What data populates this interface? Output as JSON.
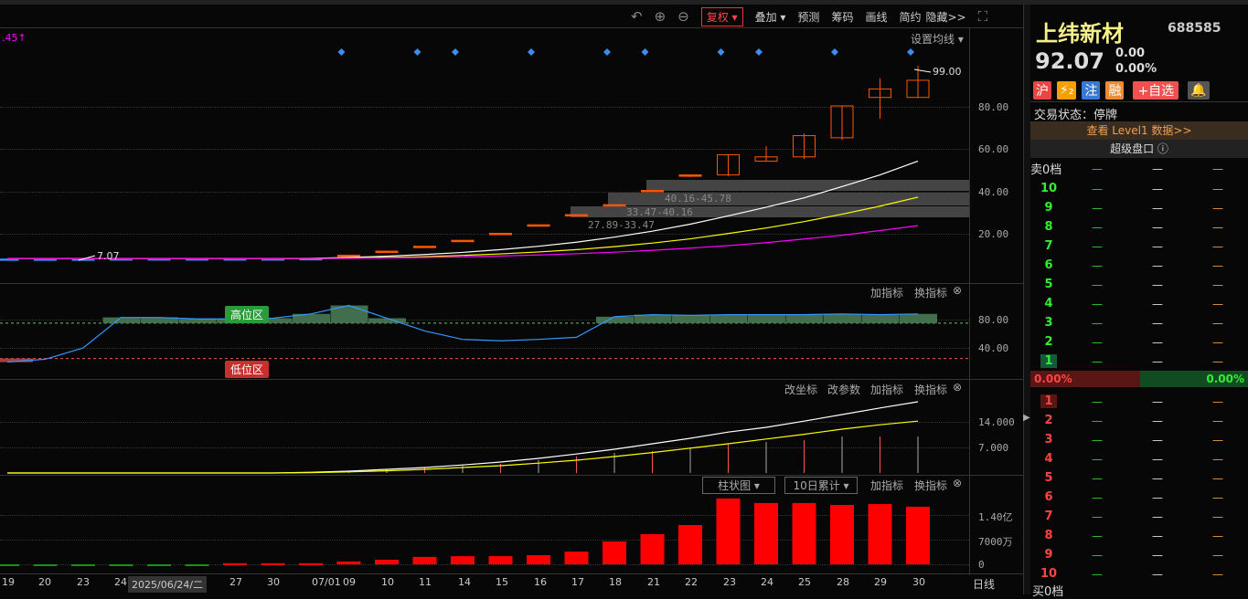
{
  "toolbar": {
    "icons": [
      "undo-icon",
      "zoom-in-icon",
      "zoom-out-icon",
      "fullscreen-icon"
    ],
    "fuquan": "复权 ▾",
    "overlay": "叠加 ▾",
    "forecast": "预测",
    "chips": "筹码",
    "draw": "画线",
    "simple": "简约",
    "hide": "隐藏>>"
  },
  "main": {
    "top_left": ".45↑",
    "ma_setting": "设置均线 ▾",
    "max_label": "99.00",
    "min_label": "7.07",
    "price_ticks": [
      "80.00",
      "60.00",
      "40.00",
      "20.00"
    ],
    "chip_labels": [
      "40.16-45.78",
      "33.47-40.16",
      "27.89-33.47"
    ]
  },
  "osc": {
    "add": "加指标",
    "switch": "换指标",
    "high": "高位区",
    "low": "低位区",
    "ticks": [
      "80.00",
      "40.00"
    ]
  },
  "ind": {
    "coord": "改坐标",
    "param": "改参数",
    "add": "加指标",
    "switch": "换指标",
    "ticks": [
      "14.000",
      "7.000"
    ]
  },
  "vol": {
    "type": "柱状图 ▾",
    "accum": "10日累计 ▾",
    "add": "加指标",
    "switch": "换指标",
    "ticks": [
      "1.40亿",
      "7000万",
      "0"
    ]
  },
  "dates": [
    "19",
    "20",
    "23",
    "24",
    "2025/06/24/二",
    "27",
    "30",
    "07/01",
    "09",
    "10",
    "11",
    "14",
    "15",
    "16",
    "17",
    "18",
    "21",
    "22",
    "23",
    "24",
    "25",
    "28",
    "29",
    "30"
  ],
  "period": "日线",
  "chart_data": {
    "type": "candlestick",
    "x": [
      "19",
      "20",
      "23",
      "24",
      "25",
      "26",
      "27",
      "30",
      "07/01",
      "09",
      "10",
      "11",
      "14",
      "15",
      "16",
      "17",
      "18",
      "21",
      "22",
      "23",
      "24",
      "25",
      "28",
      "29",
      "30"
    ],
    "ohlc": [
      [
        7.9,
        8,
        7.8,
        7.9
      ],
      [
        7.9,
        8,
        7.8,
        7.9
      ],
      [
        7.9,
        8,
        7.07,
        7.9
      ],
      [
        8,
        8,
        7.9,
        8
      ],
      [
        8,
        8,
        7.9,
        8
      ],
      [
        8,
        8,
        7.9,
        8
      ],
      [
        8,
        8.1,
        7.9,
        8
      ],
      [
        8,
        8.2,
        7.9,
        8
      ],
      [
        8,
        8.3,
        7.9,
        8.1
      ],
      [
        9.7,
        9.7,
        9.7,
        9.7
      ],
      [
        11.6,
        11.6,
        11.6,
        11.6
      ],
      [
        13.9,
        13.9,
        13.9,
        13.9
      ],
      [
        16.7,
        16.7,
        16.7,
        16.7
      ],
      [
        20,
        20,
        20,
        20
      ],
      [
        24,
        24,
        24,
        24
      ],
      [
        28.8,
        28.8,
        28.8,
        28.8
      ],
      [
        33.5,
        33.5,
        33.5,
        33.5
      ],
      [
        40.2,
        40.2,
        40.2,
        40.2
      ],
      [
        47.5,
        47.5,
        46.5,
        47.5
      ],
      [
        47.5,
        57,
        47,
        57
      ],
      [
        54,
        61,
        54,
        56
      ],
      [
        56,
        67,
        55,
        66
      ],
      [
        65,
        80,
        64,
        80
      ],
      [
        84,
        93,
        74,
        88
      ],
      [
        84,
        99,
        84,
        92.07
      ]
    ],
    "ma_white": [
      8,
      8,
      8,
      8,
      8,
      8,
      8,
      8,
      8.2,
      8.6,
      9.2,
      10,
      11,
      12.3,
      13.9,
      15.8,
      18.2,
      21,
      24.3,
      28.2,
      32.3,
      36.7,
      42,
      47.5,
      54
    ],
    "ma_yellow": [
      8,
      8,
      8,
      8,
      8,
      8,
      8,
      8,
      8.1,
      8.3,
      8.6,
      9,
      9.6,
      10.3,
      11.2,
      12.3,
      13.7,
      15.4,
      17.4,
      19.9,
      22.5,
      25.5,
      29,
      32.8,
      37
    ],
    "ma_magenta": [
      8,
      8,
      8,
      8,
      8,
      8,
      8,
      8,
      8.1,
      8.2,
      8.4,
      8.6,
      8.9,
      9.3,
      9.8,
      10.4,
      11.1,
      12,
      13,
      14.2,
      15.6,
      17.3,
      19.1,
      21.3,
      23.6
    ],
    "osc": [
      20,
      24,
      40,
      83,
      83,
      81,
      81,
      82,
      88,
      100,
      82,
      64,
      52,
      50,
      52,
      55,
      84,
      87,
      86,
      87,
      87,
      87,
      88,
      87,
      88
    ],
    "ind_white": [
      0,
      0,
      0,
      0,
      0,
      0,
      0,
      0,
      0.2,
      0.5,
      1,
      1.5,
      2.2,
      3,
      4,
      5.2,
      6.5,
      8,
      9.5,
      11.2,
      12.5,
      14.2,
      16,
      17.8,
      19.5
    ],
    "ind_yellow": [
      0,
      0,
      0,
      0,
      0,
      0,
      0,
      0,
      0.1,
      0.3,
      0.6,
      1,
      1.5,
      2,
      2.7,
      3.5,
      4.5,
      5.6,
      6.8,
      8,
      9.3,
      10.6,
      12,
      13.2,
      14.2
    ],
    "ind_sticks": [
      0,
      0,
      0,
      0,
      0,
      0,
      0,
      0,
      0.3,
      0.6,
      1,
      1.5,
      2,
      2.5,
      3.5,
      4.5,
      5.5,
      6,
      7,
      8,
      8.5,
      9,
      10,
      10,
      10
    ],
    "volume_wan": [
      -200,
      -200,
      -200,
      -150,
      -150,
      -150,
      300,
      300,
      300,
      800,
      1300,
      2100,
      2300,
      2300,
      2600,
      3600,
      6500,
      8550,
      11150,
      18700,
      17400,
      17400,
      16850,
      17100,
      16350
    ],
    "colors": {
      "up": "#ff5500",
      "vol_up": "#ff0000",
      "vol_down": "#1a8f1a",
      "ma1": "#ffffff",
      "ma2": "#ffff00",
      "ma3": "#ff00ff",
      "osc": "#3399ff"
    }
  },
  "quote": {
    "name": "上纬新材",
    "code": "688585",
    "price": "92.07",
    "change": "0.00",
    "pct": "0.00%",
    "badges": [
      "沪",
      "⚡₂",
      "注",
      "融",
      "+自选"
    ],
    "status": "交易状态：停牌",
    "level1": "查看 Level1 数据>>",
    "super": "超级盘口 ⓘ",
    "sell_head": "卖0档",
    "buy_head": "买0档",
    "ratio_left": "0.00%",
    "ratio_right": "0.00%",
    "sell": [
      "10",
      "9",
      "8",
      "7",
      "6",
      "5",
      "4",
      "3",
      "2",
      "1"
    ],
    "buy": [
      "1",
      "2",
      "3",
      "4",
      "5",
      "6",
      "7",
      "8",
      "9",
      "10"
    ],
    "dash": "—"
  }
}
